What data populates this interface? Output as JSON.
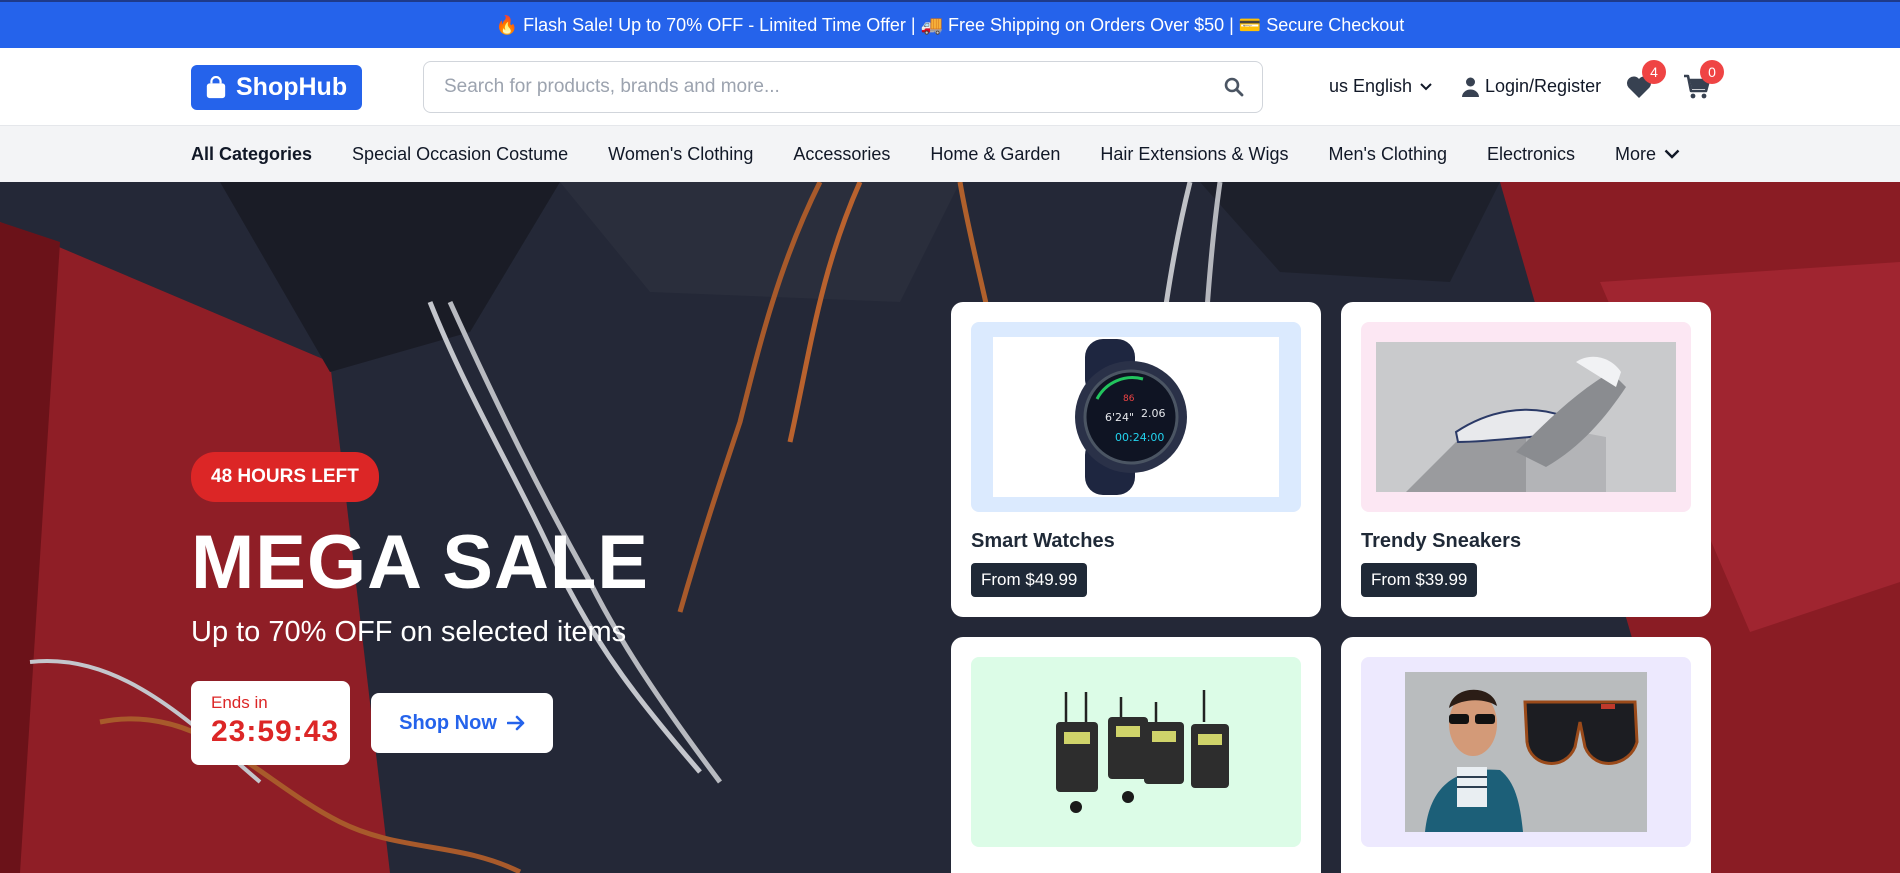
{
  "announcement": {
    "text": "🔥 Flash Sale! Up to 70% OFF - Limited Time Offer | 🚚 Free Shipping on Orders Over $50 | 💳 Secure Checkout"
  },
  "header": {
    "logo_text": "ShopHub",
    "search_placeholder": "Search for products, brands and more...",
    "search_value": "",
    "language_label": "us English",
    "login_label": "Login/Register",
    "wishlist_count": "4",
    "cart_count": "0"
  },
  "categories": {
    "items": [
      "All Categories",
      "Special Occasion Costume",
      "Women's Clothing",
      "Accessories",
      "Home & Garden",
      "Hair Extensions & Wigs",
      "Men's Clothing",
      "Electronics"
    ],
    "more_label": "More"
  },
  "hero": {
    "badge": "48 HOURS LEFT",
    "title": "MEGA SALE",
    "subtitle": "Up to 70% OFF on selected items",
    "timer_label": "Ends in",
    "timer_value": "23:59:43",
    "cta_label": "Shop Now"
  },
  "products": [
    {
      "title": "Smart Watches",
      "price": "From $49.99",
      "bg": "#dbeafe"
    },
    {
      "title": "Trendy Sneakers",
      "price": "From $39.99",
      "bg": "#fce7f3"
    },
    {
      "title": "",
      "price": "",
      "bg": "#dcfce7"
    },
    {
      "title": "",
      "price": "",
      "bg": "#ede9fe"
    }
  ],
  "colors": {
    "primary": "#2563eb",
    "accent_red": "#dc2626",
    "badge_red": "#ef4444",
    "dark": "#1f2937"
  }
}
